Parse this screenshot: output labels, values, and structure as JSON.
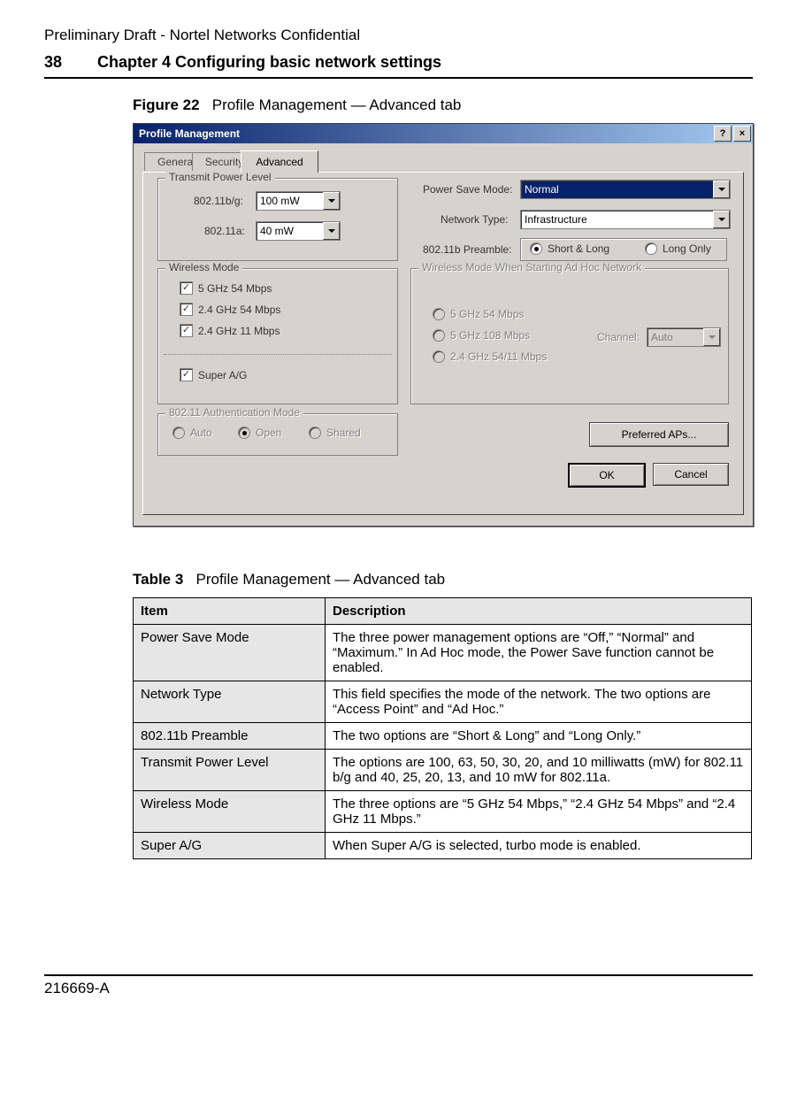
{
  "draft_notice": "Preliminary Draft - Nortel Networks Confidential",
  "page_number": "38",
  "chapter_heading": "Chapter 4 Configuring basic network settings",
  "figure": {
    "label": "Figure 22",
    "caption": "Profile Management — Advanced tab"
  },
  "dialog": {
    "title": "Profile Management",
    "tabs": {
      "general": "General",
      "security": "Security",
      "advanced": "Advanced"
    },
    "tpl": {
      "legend": "Transmit Power Level",
      "row1_label": "802.11b/g:",
      "row1_value": "100 mW",
      "row2_label": "802.11a:",
      "row2_value": "40 mW"
    },
    "right": {
      "psm_label": "Power Save Mode:",
      "psm_value": "Normal",
      "nt_label": "Network Type:",
      "nt_value": "Infrastructure",
      "preamble_label": "802.11b Preamble:",
      "preamble_opt1": "Short & Long",
      "preamble_opt2": "Long Only"
    },
    "wm": {
      "legend": "Wireless Mode",
      "opt1": "5 GHz 54 Mbps",
      "opt2": "2.4 GHz 54 Mbps",
      "opt3": "2.4 GHz 11 Mbps",
      "super": "Super A/G"
    },
    "adhoc": {
      "legend": "Wireless Mode When Starting Ad Hoc Network",
      "opt1": "5 GHz 54 Mbps",
      "opt2": "5 GHz 108 Mbps",
      "opt3": "2.4 GHz 54/11 Mbps",
      "channel_label": "Channel:",
      "channel_value": "Auto"
    },
    "auth": {
      "legend": "802.11 Authentication Mode",
      "opt1": "Auto",
      "opt2": "Open",
      "opt3": "Shared"
    },
    "buttons": {
      "pref": "Preferred APs...",
      "ok": "OK",
      "cancel": "Cancel"
    }
  },
  "table": {
    "label": "Table 3",
    "caption": "Profile Management — Advanced tab",
    "headers": {
      "item": "Item",
      "desc": "Description"
    },
    "rows": [
      {
        "item": "Power Save Mode",
        "desc": "The three power management options are “Off,” “Normal” and “Maximum.” In Ad Hoc mode, the Power Save function cannot be enabled."
      },
      {
        "item": "Network Type",
        "desc": "This field specifies the mode of the network. The two options are “Access Point” and “Ad Hoc.”"
      },
      {
        "item": "802.11b Preamble",
        "desc": "The two options are “Short & Long” and “Long Only.”"
      },
      {
        "item": "Transmit Power Level",
        "desc": "The options are 100, 63, 50, 30, 20, and 10 milliwatts (mW) for 802.11 b/g and 40, 25, 20, 13, and 10 mW for 802.11a."
      },
      {
        "item": "Wireless Mode",
        "desc": "The three options are “5 GHz 54 Mbps,” “2.4 GHz 54 Mbps” and “2.4 GHz 11 Mbps.”"
      },
      {
        "item": "Super A/G",
        "desc": "When Super A/G is selected, turbo mode is enabled."
      }
    ]
  },
  "footer_doc_id": "216669-A"
}
